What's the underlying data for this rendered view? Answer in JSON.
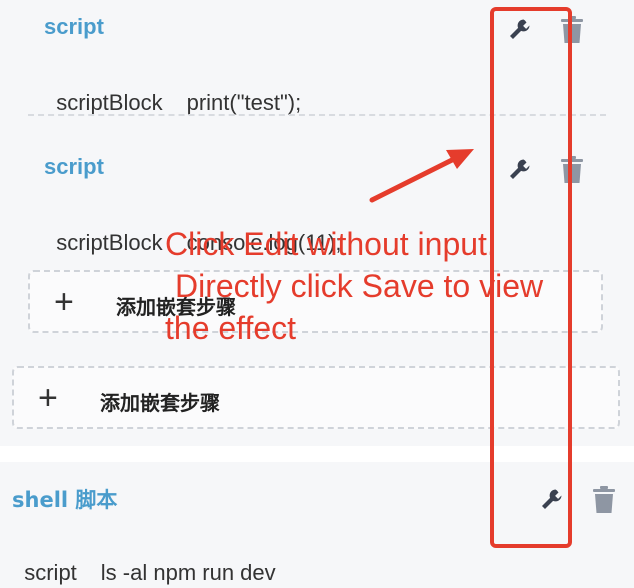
{
  "steps": [
    {
      "title": "script",
      "key": "scriptBlock",
      "value": "print(\"test\");"
    },
    {
      "title": "script",
      "key": "scriptBlock",
      "value": "console.log(11);"
    }
  ],
  "nested_add": {
    "label": "添加嵌套步骤",
    "icon": "plus-icon"
  },
  "outer_add": {
    "label": "添加嵌套步骤",
    "icon": "plus-icon"
  },
  "shell": {
    "title": "shell 脚本",
    "key": "script",
    "value": "ls -al npm run dev"
  },
  "icons": {
    "edit": "wrench-icon",
    "delete": "trash-icon"
  },
  "annotation": {
    "line1": "Click Edit without input.",
    "line2": "Directly click Save to view",
    "line3": "the effect",
    "color": "#e53c2c"
  },
  "colors": {
    "title": "#4a9ccc",
    "panel": "#f6f7f9",
    "icon": "#3a4150",
    "trash": "#8e96a3"
  }
}
